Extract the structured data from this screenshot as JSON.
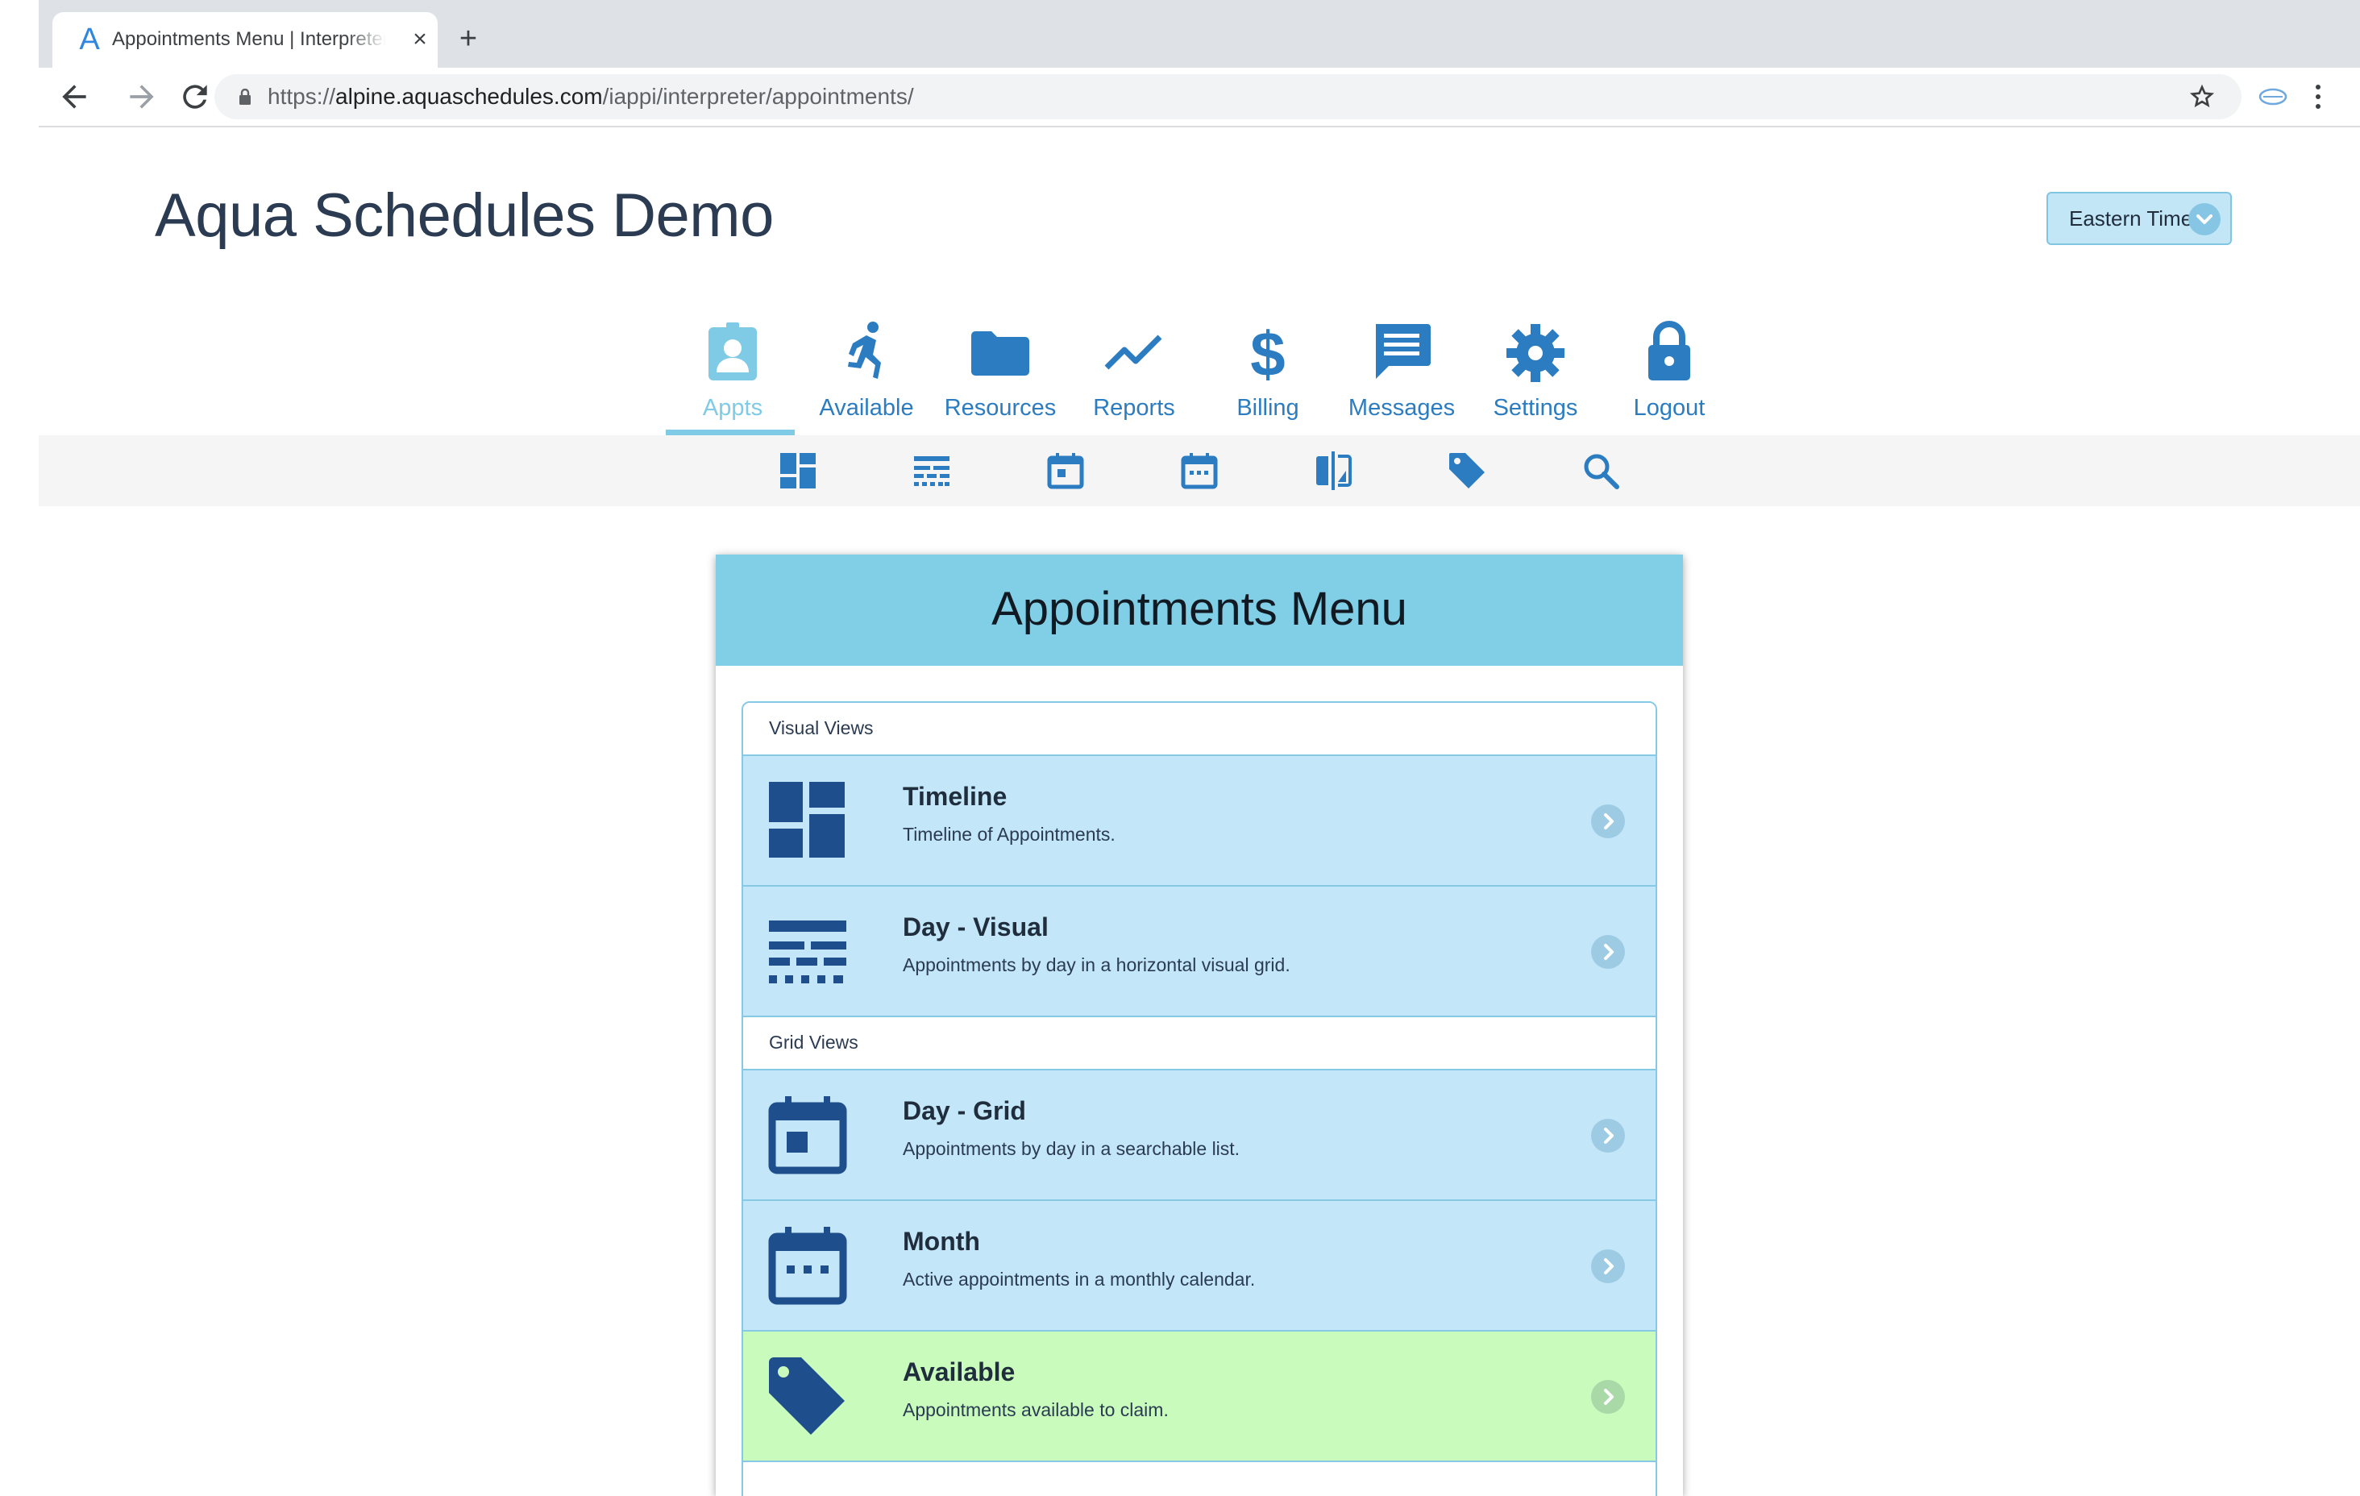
{
  "browser": {
    "tab_title": "Appointments Menu | Interpreter",
    "favicon_letter": "A",
    "tab_close": "×",
    "new_tab": "+",
    "url_scheme": "https://",
    "url_host": "alpine.aquaschedules.com",
    "url_path": "/iappi/interpreter/appointments/"
  },
  "header": {
    "site_title": "Aqua Schedules Demo",
    "timezone": "Eastern Time"
  },
  "main_nav": {
    "active": "Appts",
    "items": [
      {
        "label": "Appts",
        "icon": "badge-icon"
      },
      {
        "label": "Available",
        "icon": "running-person-icon"
      },
      {
        "label": "Resources",
        "icon": "folder-icon"
      },
      {
        "label": "Reports",
        "icon": "trend-line-icon"
      },
      {
        "label": "Billing",
        "icon": "dollar-icon"
      },
      {
        "label": "Messages",
        "icon": "message-icon"
      },
      {
        "label": "Settings",
        "icon": "gear-icon"
      },
      {
        "label": "Logout",
        "icon": "lock-icon"
      }
    ]
  },
  "sub_nav": {
    "icons": [
      "dashboard-icon",
      "day-visual-icon",
      "day-grid-calendar-icon",
      "month-calendar-icon",
      "compare-icon",
      "tag-icon",
      "search-icon"
    ]
  },
  "panel": {
    "title": "Appointments Menu",
    "sections": [
      {
        "heading": "Visual Views",
        "items": [
          {
            "title": "Timeline",
            "description": "Timeline of Appointments."
          },
          {
            "title": "Day - Visual",
            "description": "Appointments by day in a horizontal visual grid."
          }
        ]
      },
      {
        "heading": "Grid Views",
        "items": [
          {
            "title": "Day - Grid",
            "description": "Appointments by day in a searchable list."
          },
          {
            "title": "Month",
            "description": "Active appointments in a monthly calendar."
          },
          {
            "title": "Available",
            "description": "Appointments available to claim."
          }
        ]
      }
    ]
  },
  "colors": {
    "nav_blue": "#2b7cc0",
    "active_cyan": "#7fcbe6",
    "row_blue": "#c3e6f8",
    "row_green": "#c9fbbd",
    "icon_dark": "#1f4e8c"
  }
}
